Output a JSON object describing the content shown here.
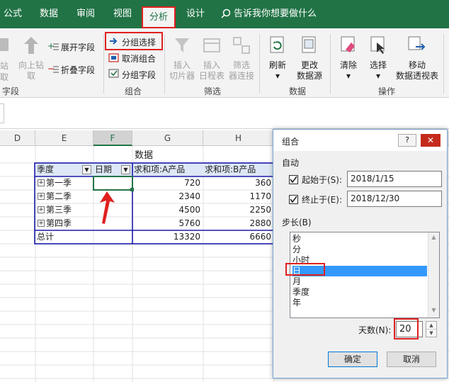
{
  "tabs": [
    "公式",
    "数据",
    "审阅",
    "视图",
    "分析",
    "设计"
  ],
  "active_tab": "分析",
  "tell_me": "告诉我你想要做什么",
  "ribbon": {
    "field_group": {
      "partial_left_top": "站",
      "partial_left_bottom": "取",
      "drill_up_top": "向上钻",
      "drill_up_bottom": "取",
      "expand_field": "展开字段",
      "collapse_field": "折叠字段",
      "label": "字段"
    },
    "group_group": {
      "group_selection": "分组选择",
      "ungroup": "取消组合",
      "group_field": "分组字段",
      "label": "组合"
    },
    "filter_group": {
      "insert_slicer_top": "插入",
      "insert_slicer_bottom": "切片器",
      "insert_timeline_top": "插入",
      "insert_timeline_bottom": "日程表",
      "filter_connections_top": "筛选",
      "filter_connections_bottom": "器连接",
      "label": "筛选"
    },
    "data_group": {
      "refresh": "刷新",
      "change_source_top": "更改",
      "change_source_bottom": "数据源",
      "label": "数据"
    },
    "actions_group": {
      "clear": "清除",
      "select": "选择",
      "move_top": "移动",
      "move_bottom": "数据透视表",
      "label": "操作"
    }
  },
  "columns": [
    "D",
    "E",
    "F",
    "G",
    "H"
  ],
  "selected_column": "F",
  "pivot": {
    "data_header": "数据",
    "col1": "季度",
    "col2": "日期",
    "col3": "求和项:A产品",
    "col4": "求和项:B产品",
    "rows": [
      {
        "label": "第一季",
        "a": "720",
        "b": "360"
      },
      {
        "label": "第二季",
        "a": "2340",
        "b": "1170"
      },
      {
        "label": "第三季",
        "a": "4500",
        "b": "2250"
      },
      {
        "label": "第四季",
        "a": "5760",
        "b": "2880"
      }
    ],
    "total_label": "总计",
    "total_a": "13320",
    "total_b": "6660"
  },
  "dialog": {
    "title": "组合",
    "help": "?",
    "close": "✕",
    "auto_label": "自动",
    "start_label": "起始于(S):",
    "start_value": "2018/1/15",
    "end_label": "终止于(E):",
    "end_value": "2018/12/30",
    "step_label": "步长(B)",
    "step_options": [
      "秒",
      "分",
      "小时",
      "日",
      "月",
      "季度",
      "年"
    ],
    "selected_step": "日",
    "days_label": "天数(N):",
    "days_value": "20",
    "ok": "确定",
    "cancel": "取消"
  },
  "colors": {
    "accent": "#217346",
    "highlight": "#e02020",
    "selection": "#3399ff",
    "pivot_border": "#1a1aa8"
  }
}
